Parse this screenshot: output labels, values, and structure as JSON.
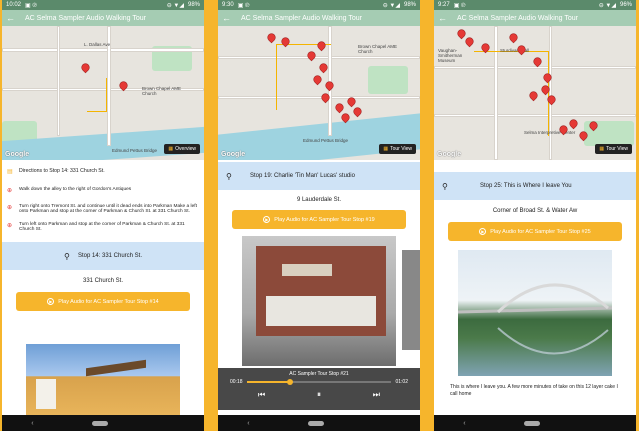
{
  "screens": [
    {
      "status": {
        "time": "10:02",
        "battery": "98%"
      },
      "app_title": "AC Selma Sampler Audio Walking Tour",
      "map": {
        "labels": [
          "L. Dallas Ave",
          "Brown Chapel AME Church",
          "Edmund Pettus Bridge"
        ],
        "button": "Overview",
        "google": "Google"
      },
      "directions_header": "Directions to Stop 14: 331 Church St.",
      "directions": [
        "Walk down the alley to the right of Gordon's Antiques",
        "Turn right onto Tremont St. and continue until it dead ends into Parkman Make a left onto Parkman and stop at the corner of Parkman & Church St. at 331 Church St.",
        "Turn left onto Parkman and stop at the corner of Parkman & Church St. at 331 Church St."
      ],
      "stop_title": "Stop 14: 331 Church St.",
      "address": "331 Church St.",
      "play_label": "Play Audio for AC Sampler Tour Stop #14"
    },
    {
      "status": {
        "time": "9:30",
        "battery": "98%"
      },
      "app_title": "AC Selma Sampler Audio Walking Tour",
      "map": {
        "labels": [
          "Brown Chapel AME Church",
          "Edmund Pettus Bridge"
        ],
        "button": "Tour View",
        "google": "Google"
      },
      "stop_title": "Stop 19: Charlie 'Tin Man' Lucas' studio",
      "address": "9 Lauderdale St.",
      "play_label": "Play Audio for AC Sampler Tour Stop #19",
      "player": {
        "title": "AC Sampler Tour Stop #21",
        "elapsed": "00:18",
        "duration": "01:02",
        "progress": 0.3
      }
    },
    {
      "status": {
        "time": "9:27",
        "battery": "96%"
      },
      "app_title": "AC Selma Sampler Audio Walking Tour",
      "map": {
        "labels": [
          "Vaughan-Smitherman Museum",
          "Sturdivant Hall",
          "Selma Interpretive Center"
        ],
        "button": "Tour View",
        "google": "Google"
      },
      "stop_title": "Stop 25: This is Where I leave You",
      "address": "Corner of Broad St. & Water Aw",
      "play_label": "Play Audio for AC Sampler Tour Stop #25",
      "caption": "This is where I leave you. A few more minutes of take on this 12 layer cake I call home"
    }
  ]
}
